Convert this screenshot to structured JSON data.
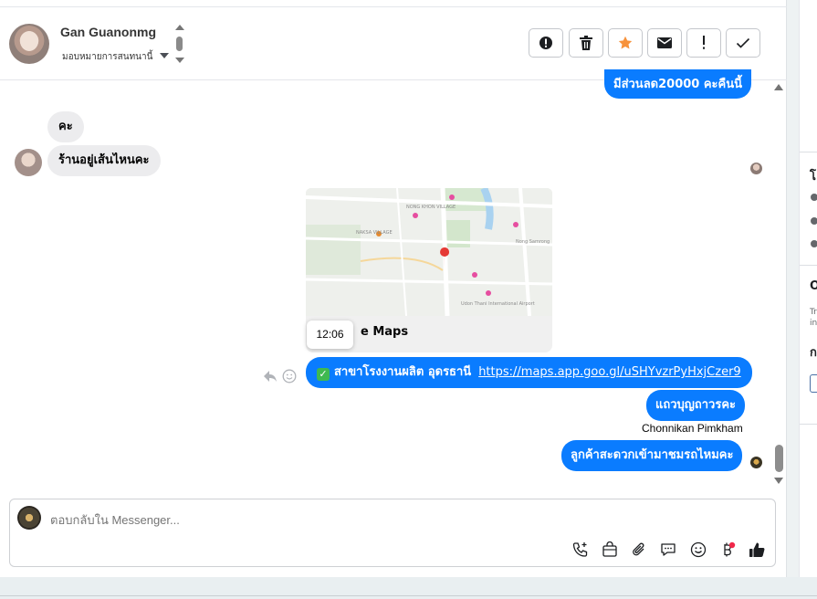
{
  "header": {
    "contact_name": "Gan Guanonmg",
    "assign_label": "มอบหมายการสนทนานี้",
    "actions": [
      {
        "name": "alert-circle-icon"
      },
      {
        "name": "trash-icon"
      },
      {
        "name": "star-icon",
        "color": "#f7923b"
      },
      {
        "name": "envelope-icon"
      },
      {
        "name": "exclamation-icon"
      },
      {
        "name": "check-icon"
      }
    ]
  },
  "messages": {
    "partial_out": "มีส่วนลด20000 คะคืนนี้",
    "in_1": "คะ",
    "in_2": "ร้านอยู่เส้นไหนคะ",
    "map_card_title": "e Maps",
    "map_tooltip_time": "12:06",
    "map_labels": {
      "nongkhon": "NONG KHON VILLAGE",
      "naksa": "NAKSA VILLAGE",
      "airport": "Udon Thani International Airport",
      "nongsamrong": "Nong Samrong"
    },
    "out_location_prefix": "สาขาโรงงานผลิต อุดรธานี",
    "out_location_link": "https://maps.app.goo.gl/uSHYvzrPyHxjCzer9",
    "out_2": "แถวบุญถาวรคะ",
    "sender_name": "Chonnikan Pimkham",
    "out_3": "ลูกค้าสะดวกเข้ามาชมรถไหมคะ"
  },
  "composer": {
    "placeholder": "ตอบกลับใน Messenger..."
  },
  "colors": {
    "brand_blue": "#0a7cff",
    "incoming_bubble": "#ececee",
    "star_orange": "#f7923b",
    "notification_dot": "#f02849"
  },
  "side": {
    "letter_1": "โ",
    "letter_2": "O",
    "letter_3": "ก",
    "small_1": "Tr",
    "small_2": "in"
  }
}
